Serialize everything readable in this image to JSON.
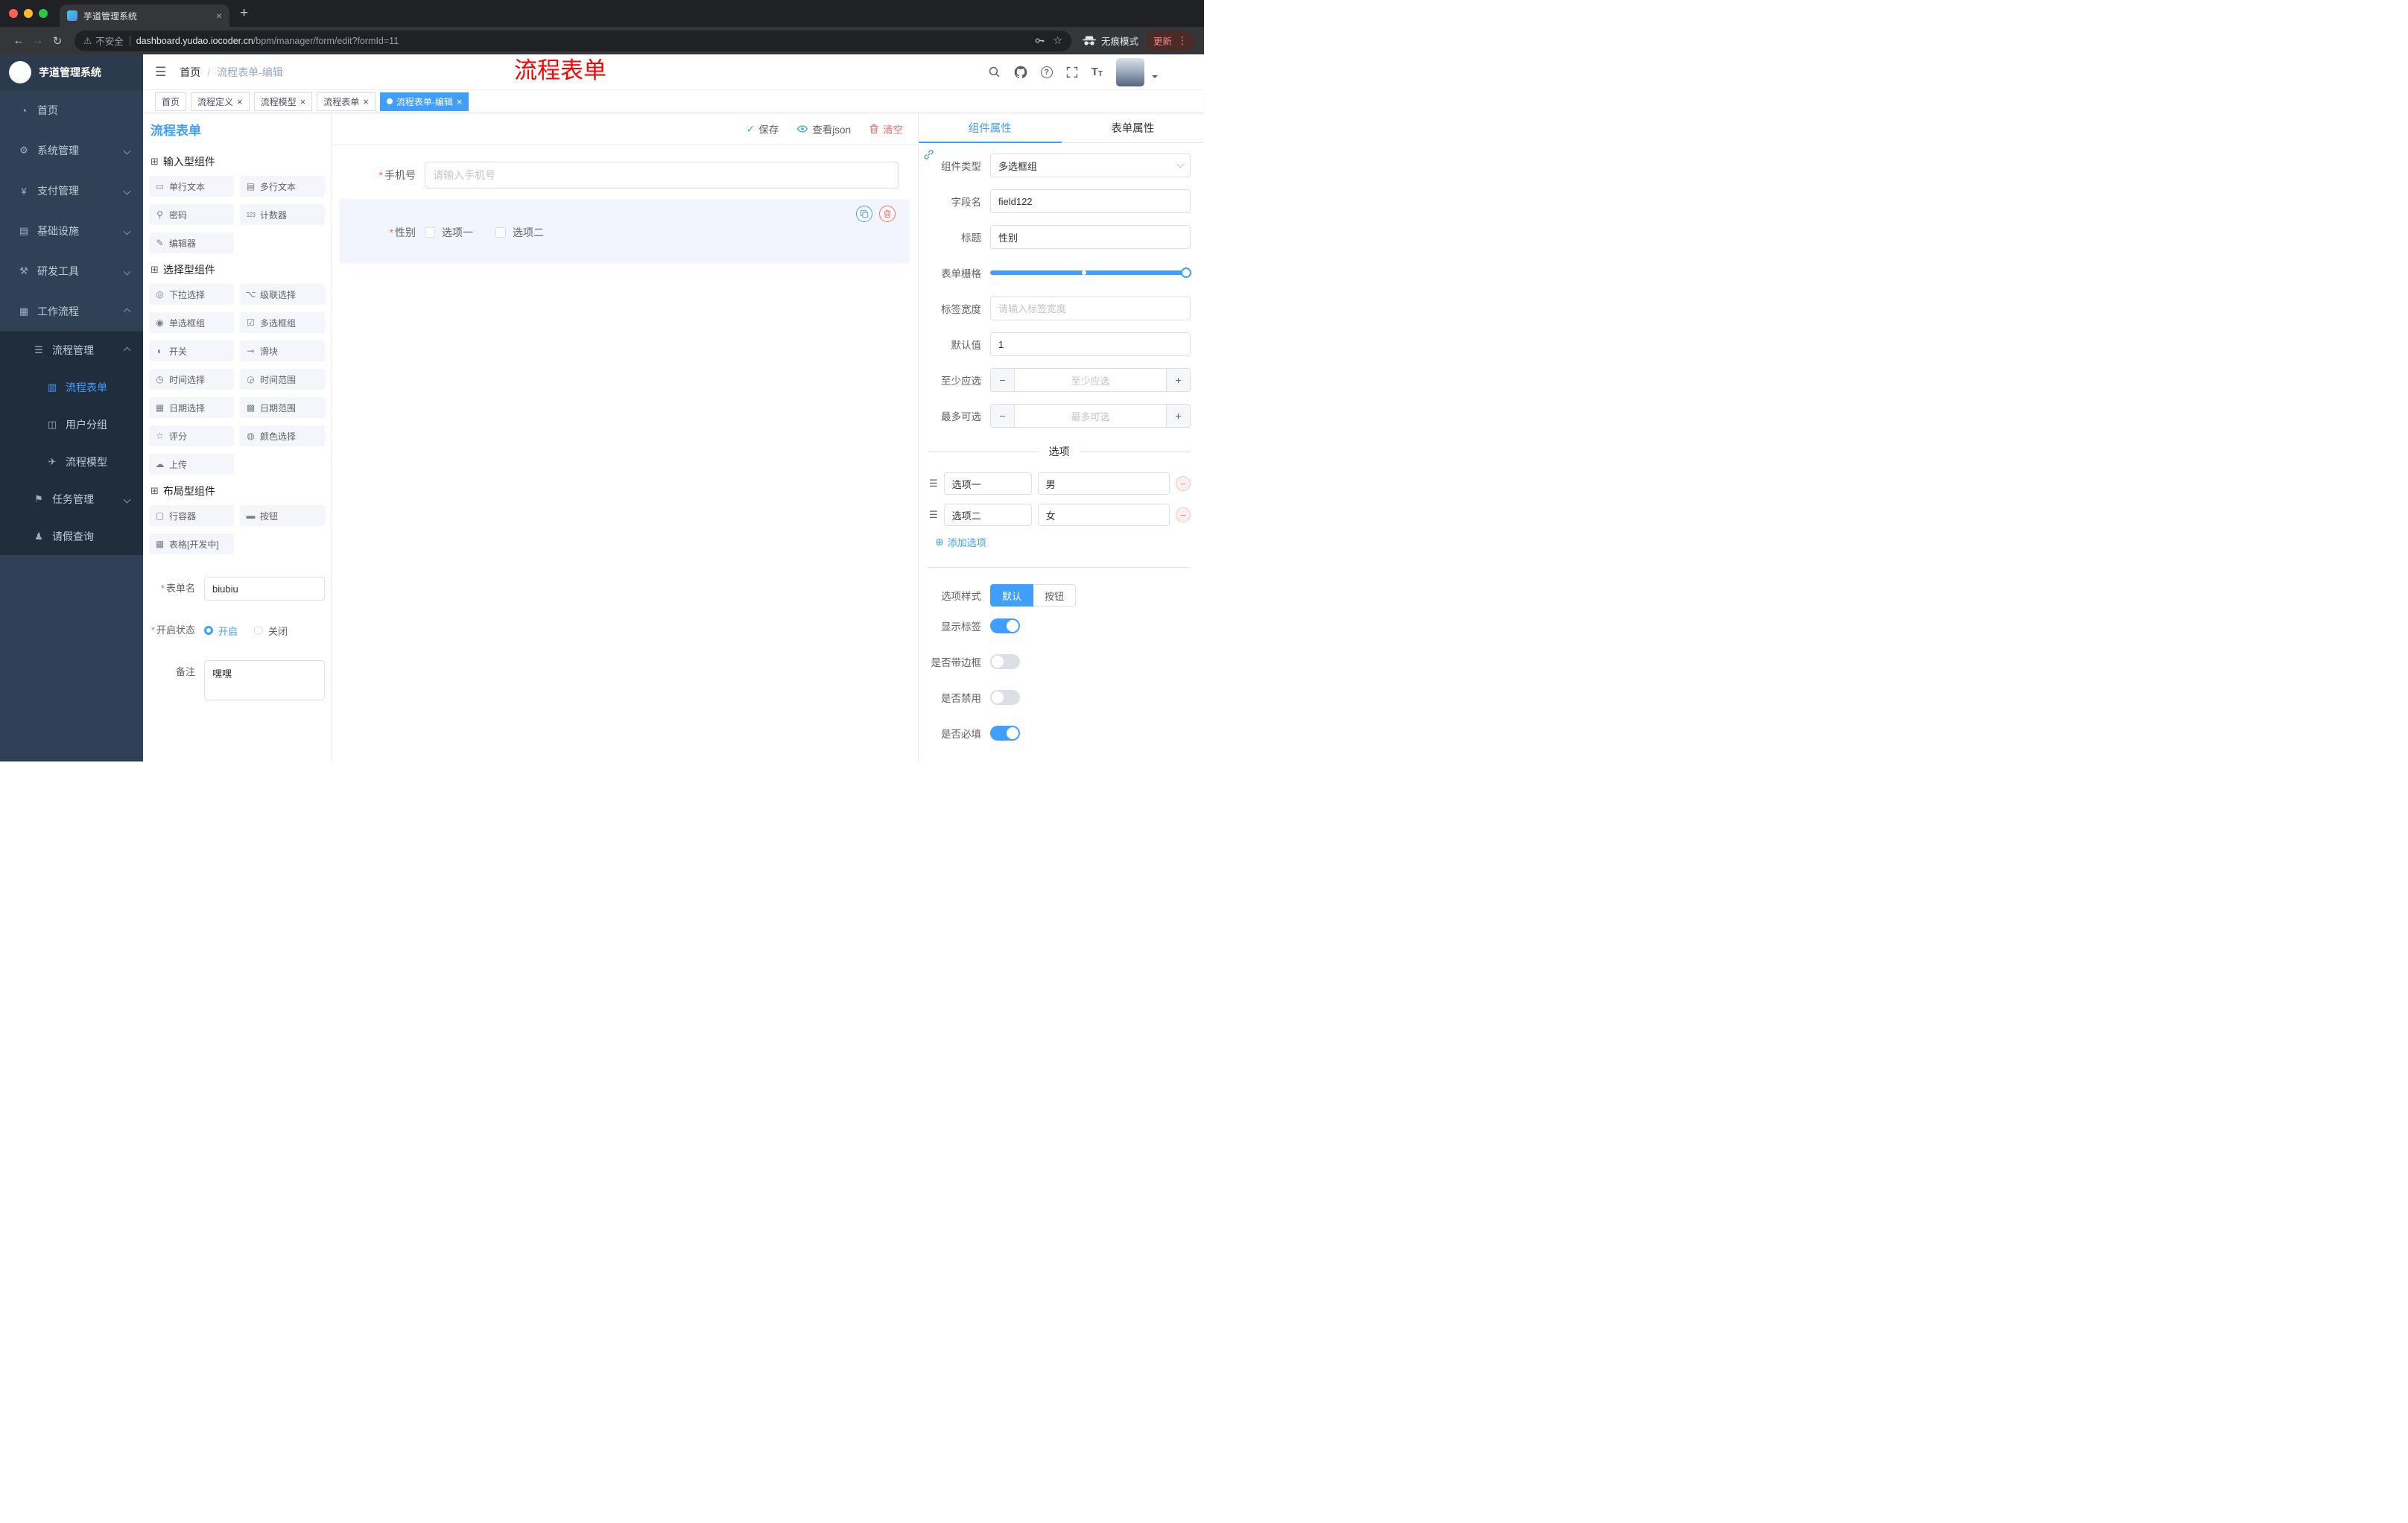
{
  "colors": {
    "primary": "#409EFF",
    "danger": "#F56C6C",
    "annotation": "#FF0000"
  },
  "annotation": {
    "text": "流程表单"
  },
  "glyphs": {
    "back": "←",
    "forward": "→",
    "reload": "↻",
    "new_tab": "+",
    "tab_close": "×",
    "warning": "⚠",
    "star": "☆",
    "menu_dots": "⋮",
    "hamburger": "☰",
    "breadcrumb_sep": "/",
    "question": "?",
    "font_big": "T",
    "font_small": "T",
    "check": "✓",
    "required": "*",
    "tag_close": "×",
    "add_circle": "⊕",
    "minus": "−",
    "plus": "+",
    "drag": "☰",
    "group_cube": "⊞"
  },
  "browser": {
    "tab_title": "芋道管理系统",
    "address": {
      "warning_label": "不安全",
      "domain": "dashboard.yudao.iocoder.cn",
      "path": "/bpm/manager/form/edit?formId=11"
    },
    "incognito_label": "无痕模式",
    "update_label": "更新"
  },
  "sidebar": {
    "app_title": "芋道管理系统",
    "items": [
      {
        "label": "首页",
        "glyph": "◔"
      },
      {
        "label": "系统管理",
        "glyph": "⚙"
      },
      {
        "label": "支付管理",
        "glyph": "¥"
      },
      {
        "label": "基础设施",
        "glyph": "▤"
      },
      {
        "label": "研发工具",
        "glyph": "⚒"
      },
      {
        "label": "工作流程",
        "glyph": "▦"
      },
      {
        "label": "流程管理",
        "glyph": "☰"
      },
      {
        "label": "流程表单",
        "glyph": "▥"
      },
      {
        "label": "用户分组",
        "glyph": "◫"
      },
      {
        "label": "流程模型",
        "glyph": "✈"
      },
      {
        "label": "任务管理",
        "glyph": "⚑"
      },
      {
        "label": "请假查询",
        "glyph": "♟"
      }
    ]
  },
  "header": {
    "breadcrumb_home": "首页",
    "breadcrumb_current": "流程表单-编辑"
  },
  "tags": [
    {
      "label": "首页"
    },
    {
      "label": "流程定义"
    },
    {
      "label": "流程模型"
    },
    {
      "label": "流程表单"
    },
    {
      "label": "流程表单-编辑"
    }
  ],
  "left_panel": {
    "title": "流程表单",
    "groups": [
      {
        "title": "输入型组件",
        "items": [
          {
            "glyph": "▭",
            "label": "单行文本"
          },
          {
            "glyph": "▤",
            "label": "多行文本"
          },
          {
            "glyph": "⚲",
            "label": "密码"
          },
          {
            "glyph": "123",
            "label": "计数器"
          },
          {
            "glyph": "✎",
            "label": "编辑器"
          }
        ]
      },
      {
        "title": "选择型组件",
        "items": [
          {
            "glyph": "◎",
            "label": "下拉选择"
          },
          {
            "glyph": "⌥",
            "label": "级联选择"
          },
          {
            "glyph": "◉",
            "label": "单选框组"
          },
          {
            "glyph": "☑",
            "label": "多选框组"
          },
          {
            "glyph": "◐",
            "label": "开关"
          },
          {
            "glyph": "⊸",
            "label": "滑块"
          },
          {
            "glyph": "◷",
            "label": "时间选择"
          },
          {
            "glyph": "◶",
            "label": "时间范围"
          },
          {
            "glyph": "▦",
            "label": "日期选择"
          },
          {
            "glyph": "▩",
            "label": "日期范围"
          },
          {
            "glyph": "☆",
            "label": "评分"
          },
          {
            "glyph": "◍",
            "label": "颜色选择"
          },
          {
            "glyph": "☁",
            "label": "上传"
          }
        ]
      },
      {
        "title": "布局型组件",
        "items": [
          {
            "glyph": "▢",
            "label": "行容器"
          },
          {
            "glyph": "▬",
            "label": "按钮"
          },
          {
            "glyph": "▦",
            "label": "表格[开发中]"
          }
        ]
      }
    ],
    "form": {
      "name_label": "表单名",
      "name_value": "biubiu",
      "status_label": "开启状态",
      "status_on": "开启",
      "status_off": "关闭",
      "remark_label": "备注",
      "remark_value": "嘿嘿"
    }
  },
  "toolbar": {
    "save": "保存",
    "view_json": "查看json",
    "clear": "清空"
  },
  "canvas": {
    "phone_label": "手机号",
    "phone_placeholder": "请输入手机号",
    "gender_label": "性别",
    "gender_option1": "选项一",
    "gender_option2": "选项二"
  },
  "right_panel": {
    "tab_component": "组件属性",
    "tab_form": "表单属性",
    "component_type_label": "组件类型",
    "component_type_value": "多选框组",
    "field_name_label": "字段名",
    "field_name_value": "field122",
    "title_label": "标题",
    "title_value": "性别",
    "grid_label": "表单栅格",
    "label_width_label": "标签宽度",
    "label_width_placeholder": "请输入标签宽度",
    "default_label": "默认值",
    "default_value": "1",
    "min_label": "至少应选",
    "min_placeholder": "至少应选",
    "max_label": "最多可选",
    "max_placeholder": "最多可选",
    "options_title": "选项",
    "options": [
      {
        "name": "选项一",
        "value": "男"
      },
      {
        "name": "选项二",
        "value": "女"
      }
    ],
    "add_option": "添加选项",
    "style_label": "选项样式",
    "style_default": "默认",
    "style_button": "按钮",
    "switch_show_label": "显示标签",
    "switch_border_label": "是否带边框",
    "switch_disabled_label": "是否禁用",
    "switch_required_label": "是否必填"
  }
}
